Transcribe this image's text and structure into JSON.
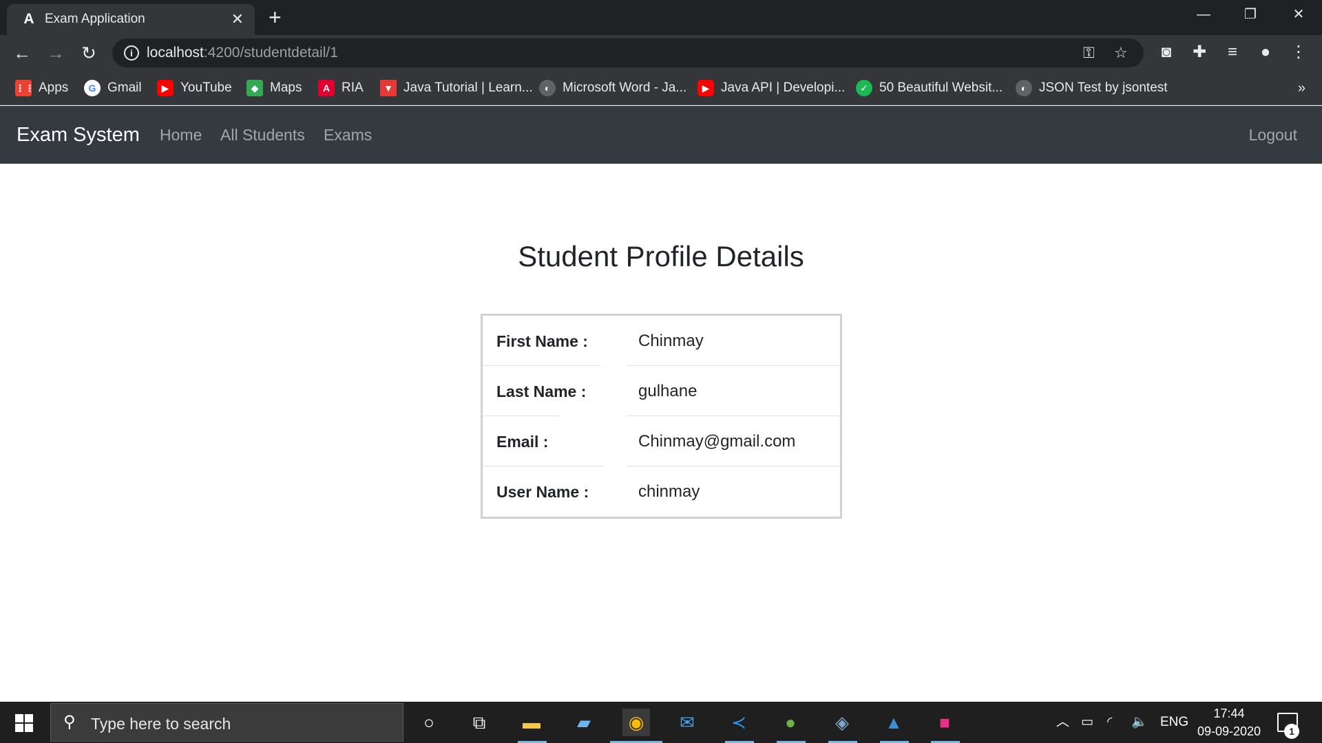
{
  "browser": {
    "tab_title": "Exam Application",
    "tab_favicon": "A",
    "url_host": "localhost",
    "url_path": ":4200/studentdetail/1",
    "bookmarks": [
      {
        "label": "Apps",
        "icon": "apps-grid-icon",
        "color": "#ea4335"
      },
      {
        "label": "Gmail",
        "icon": "google-icon",
        "color": "#4285f4"
      },
      {
        "label": "YouTube",
        "icon": "youtube-icon",
        "color": "#ff0000"
      },
      {
        "label": "Maps",
        "icon": "maps-icon",
        "color": "#34a853"
      },
      {
        "label": "RIA",
        "icon": "angular-icon",
        "color": "#dd0031"
      },
      {
        "label": "Java Tutorial | Learn...",
        "icon": "tutorial-icon",
        "color": "#e53935"
      },
      {
        "label": "Microsoft Word - Ja...",
        "icon": "globe-icon",
        "color": "#5f6368"
      },
      {
        "label": "Java API | Developi...",
        "icon": "youtube-icon",
        "color": "#ff0000"
      },
      {
        "label": "50 Beautiful Websit...",
        "icon": "check-icon",
        "color": "#1db954"
      },
      {
        "label": "JSON Test by jsontest",
        "icon": "globe-icon",
        "color": "#5f6368"
      }
    ]
  },
  "app": {
    "brand": "Exam System",
    "nav": [
      "Home",
      "All Students",
      "Exams"
    ],
    "logout": "Logout"
  },
  "main": {
    "title": "Student Profile Details",
    "fields": [
      {
        "label": "First Name :",
        "value": "Chinmay"
      },
      {
        "label": "Last Name :",
        "value": "gulhane"
      },
      {
        "label": "Email :",
        "value": "Chinmay@gmail.com"
      },
      {
        "label": "User Name :",
        "value": "chinmay"
      }
    ]
  },
  "taskbar": {
    "search_placeholder": "Type here to search",
    "language": "ENG",
    "time": "17:44",
    "date": "09-09-2020",
    "notification_count": "1"
  },
  "colors": {
    "navbar_bg": "#343a40",
    "chrome_bg": "#35363a",
    "tabstrip_bg": "#202124"
  }
}
